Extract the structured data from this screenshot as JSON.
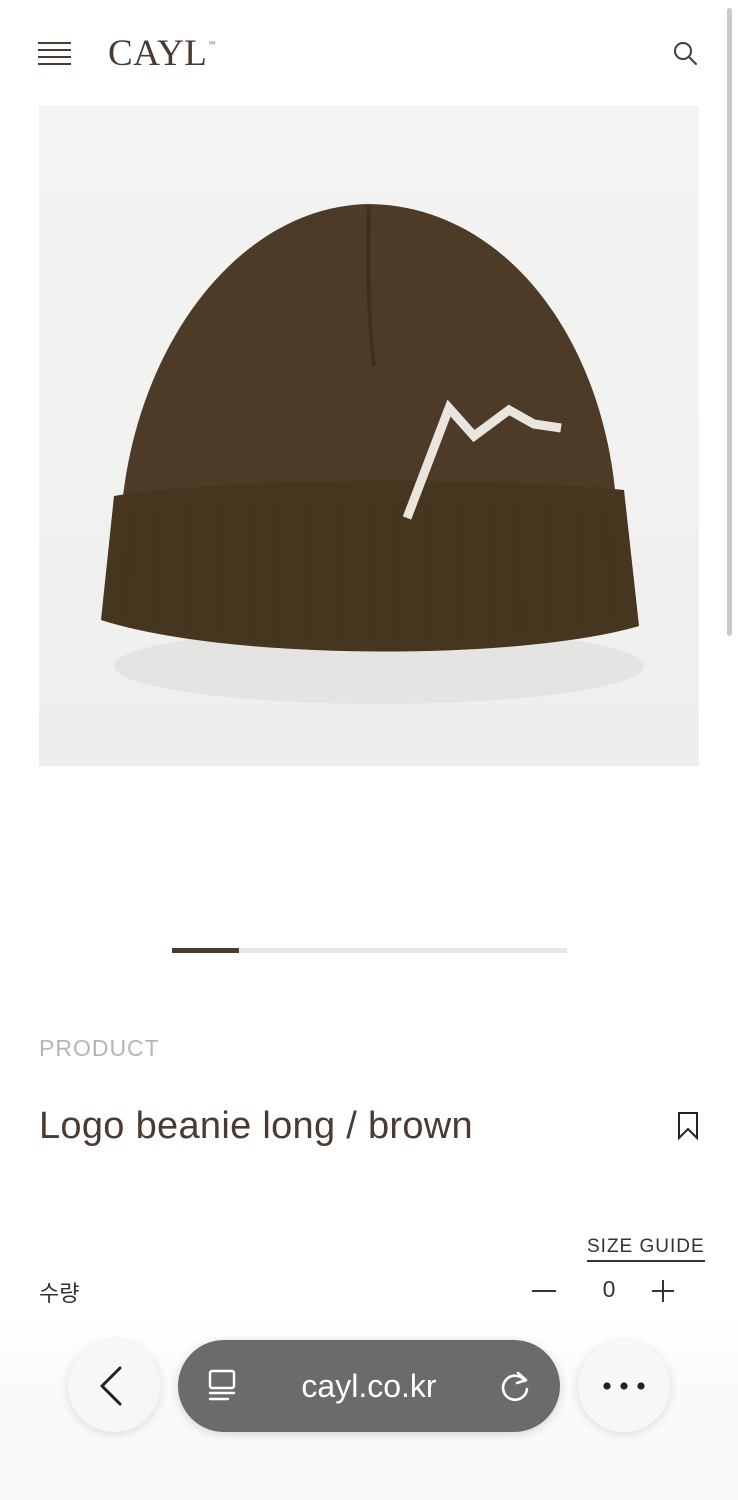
{
  "header": {
    "logo": "CAYL",
    "logo_tm": "™",
    "menu_icon": "hamburger-icon",
    "search_icon": "search-icon"
  },
  "gallery": {
    "image_subject": "brown-knit-beanie-with-white-mountain-logo",
    "slide_progress": 0.17
  },
  "product": {
    "category": "PRODUCT",
    "title": "Logo beanie long / brown",
    "bookmark_icon": "bookmark-icon",
    "size_guide": "SIZE GUIDE",
    "quantity_label": "수량",
    "quantity_value": "0",
    "minus_icon": "minus-icon",
    "plus_icon": "plus-icon"
  },
  "browser": {
    "url": "cayl.co.kr",
    "back_icon": "chevron-left-icon",
    "tab_icon": "tab-icon",
    "reload_icon": "reload-icon",
    "more_icon": "more-dots-icon"
  },
  "colors": {
    "brand_brown": "#4a3a2f",
    "beanie_brown": "#4b3a26",
    "url_bar_bg": "#6b6b6b"
  }
}
